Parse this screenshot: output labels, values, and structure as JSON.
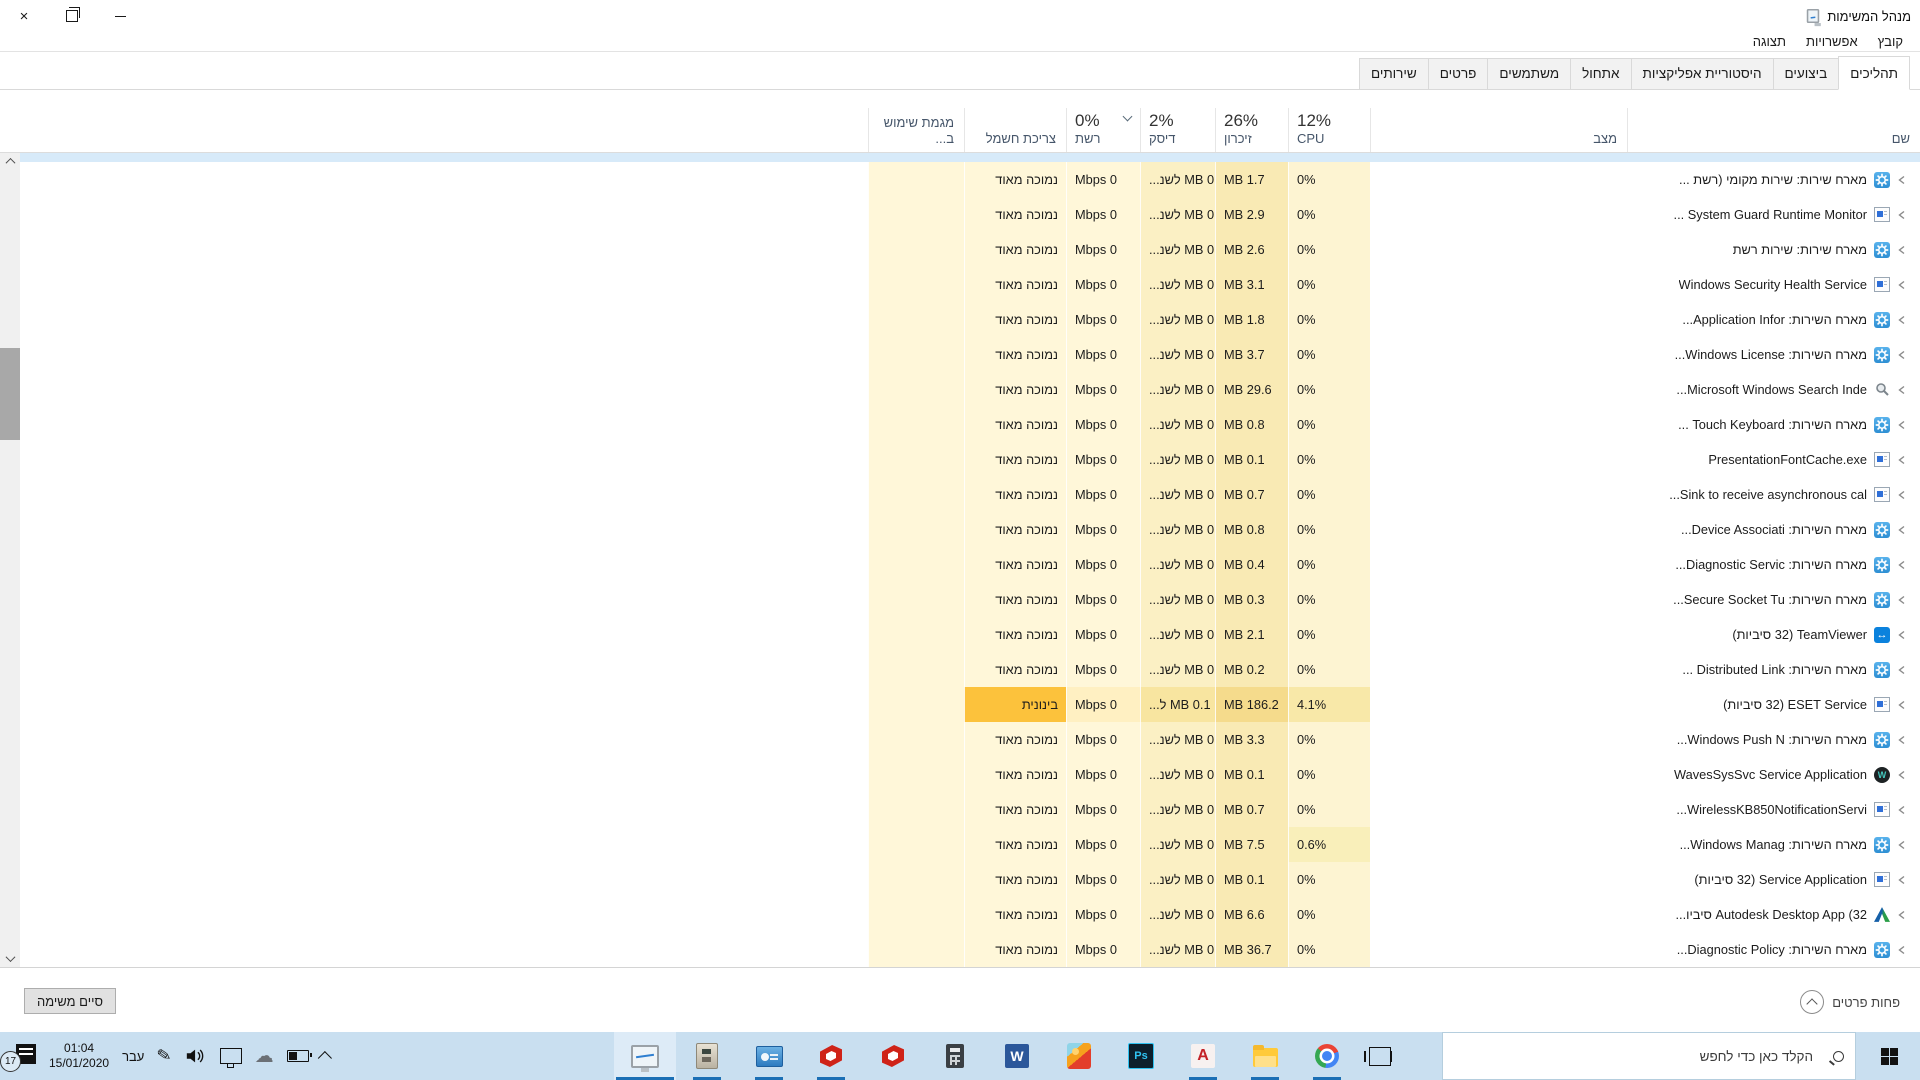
{
  "window": {
    "title": "מנהל המשימות",
    "controls": {
      "close": "×"
    }
  },
  "menu": {
    "items": [
      "קובץ",
      "אפשרויות",
      "תצוגה"
    ]
  },
  "tabs": {
    "active_index": 0,
    "items": [
      "תהליכים",
      "ביצועים",
      "היסטוריית אפליקציות",
      "אתחול",
      "משתמשים",
      "פרטים",
      "שירותים"
    ]
  },
  "columns": {
    "name": "שם",
    "status": "מצב",
    "cpu": {
      "value": "12%",
      "label": "CPU"
    },
    "memory": {
      "value": "26%",
      "label": "זיכרון"
    },
    "disk": {
      "value": "2%",
      "label": "דיסק"
    },
    "network": {
      "value": "0%",
      "label": "רשת",
      "sorted": true
    },
    "power": {
      "label": "צריכת חשמל"
    },
    "trend": {
      "label": "מגמת שימוש ב..."
    }
  },
  "table": {
    "rows": [
      {
        "icon": "gear",
        "name": "מארח שירות: שירות מקומי (רשת ...",
        "status": "",
        "cpu": "0%",
        "mem": "1.7 MB",
        "disk": "0 MB לשנ...",
        "net": "0 Mbps",
        "power": "נמוכה מאוד"
      },
      {
        "icon": "app",
        "name": "System Guard Runtime Monitor ...",
        "status": "",
        "cpu": "0%",
        "mem": "2.9 MB",
        "disk": "0 MB לשנ...",
        "net": "0 Mbps",
        "power": "נמוכה מאוד"
      },
      {
        "icon": "gear",
        "name": "מארח שירות: שירות רשת",
        "status": "",
        "cpu": "0%",
        "mem": "2.6 MB",
        "disk": "0 MB לשנ...",
        "net": "0 Mbps",
        "power": "נמוכה מאוד"
      },
      {
        "icon": "app",
        "name": "Windows Security Health Service",
        "status": "",
        "cpu": "0%",
        "mem": "3.1 MB",
        "disk": "0 MB לשנ...",
        "net": "0 Mbps",
        "power": "נמוכה מאוד"
      },
      {
        "icon": "gear",
        "name": "מארח השירות: Application Infor...",
        "status": "",
        "cpu": "0%",
        "mem": "1.8 MB",
        "disk": "0 MB לשנ...",
        "net": "0 Mbps",
        "power": "נמוכה מאוד"
      },
      {
        "icon": "gear",
        "name": "מארח השירות: Windows License...",
        "status": "",
        "cpu": "0%",
        "mem": "3.7 MB",
        "disk": "0 MB לשנ...",
        "net": "0 Mbps",
        "power": "נמוכה מאוד"
      },
      {
        "icon": "searchidx",
        "name": "Microsoft Windows Search Inde...",
        "status": "",
        "cpu": "0%",
        "mem": "29.6 MB",
        "disk": "0 MB לשנ...",
        "net": "0 Mbps",
        "power": "נמוכה מאוד"
      },
      {
        "icon": "gear",
        "name": "מארח השירות: Touch Keyboard ...",
        "status": "",
        "cpu": "0%",
        "mem": "0.8 MB",
        "disk": "0 MB לשנ...",
        "net": "0 Mbps",
        "power": "נמוכה מאוד"
      },
      {
        "icon": "app",
        "name": "PresentationFontCache.exe",
        "status": "",
        "cpu": "0%",
        "mem": "0.1 MB",
        "disk": "0 MB לשנ...",
        "net": "0 Mbps",
        "power": "נמוכה מאוד"
      },
      {
        "icon": "app",
        "name": "Sink to receive asynchronous cal...",
        "status": "",
        "cpu": "0%",
        "mem": "0.7 MB",
        "disk": "0 MB לשנ...",
        "net": "0 Mbps",
        "power": "נמוכה מאוד"
      },
      {
        "icon": "gear",
        "name": "מארח השירות: Device Associati...",
        "status": "",
        "cpu": "0%",
        "mem": "0.8 MB",
        "disk": "0 MB לשנ...",
        "net": "0 Mbps",
        "power": "נמוכה מאוד"
      },
      {
        "icon": "gear",
        "name": "מארח השירות: Diagnostic Servic...",
        "status": "",
        "cpu": "0%",
        "mem": "0.4 MB",
        "disk": "0 MB לשנ...",
        "net": "0 Mbps",
        "power": "נמוכה מאוד"
      },
      {
        "icon": "gear",
        "name": "מארח השירות: Secure Socket Tu...",
        "status": "",
        "cpu": "0%",
        "mem": "0.3 MB",
        "disk": "0 MB לשנ...",
        "net": "0 Mbps",
        "power": "נמוכה מאוד"
      },
      {
        "icon": "teamviewer",
        "name": "TeamViewer (32 סיביות)",
        "status": "",
        "cpu": "0%",
        "mem": "2.1 MB",
        "disk": "0 MB לשנ...",
        "net": "0 Mbps",
        "power": "נמוכה מאוד"
      },
      {
        "icon": "gear",
        "name": "מארח השירות: Distributed Link ...",
        "status": "",
        "cpu": "0%",
        "mem": "0.2 MB",
        "disk": "0 MB לשנ...",
        "net": "0 Mbps",
        "power": "נמוכה מאוד"
      },
      {
        "icon": "app",
        "name": "ESET Service (32 סיביות)",
        "status": "",
        "cpu": "4.1%",
        "mem": "186.2 MB",
        "disk": "0.1 MB ל...",
        "net": "0 Mbps",
        "power": "בינונית",
        "emphasis": "hot"
      },
      {
        "icon": "gear",
        "name": "מארח השירות: Windows Push N...",
        "status": "",
        "cpu": "0%",
        "mem": "3.3 MB",
        "disk": "0 MB לשנ...",
        "net": "0 Mbps",
        "power": "נמוכה מאוד"
      },
      {
        "icon": "waves",
        "name": "WavesSysSvc Service Application",
        "status": "",
        "cpu": "0%",
        "mem": "0.1 MB",
        "disk": "0 MB לשנ...",
        "net": "0 Mbps",
        "power": "נמוכה מאוד"
      },
      {
        "icon": "app",
        "name": "WirelessKB850NotificationServi...",
        "status": "",
        "cpu": "0%",
        "mem": "0.7 MB",
        "disk": "0 MB לשנ...",
        "net": "0 Mbps",
        "power": "נמוכה מאוד"
      },
      {
        "icon": "gear",
        "name": "מארח השירות: Windows Manag...",
        "status": "",
        "cpu": "0.6%",
        "mem": "7.5 MB",
        "disk": "0 MB לשנ...",
        "net": "0 Mbps",
        "power": "נמוכה מאוד",
        "emphasis": "warm"
      },
      {
        "icon": "app",
        "name": "Service Application (32 סיביות)",
        "status": "",
        "cpu": "0%",
        "mem": "0.1 MB",
        "disk": "0 MB לשנ...",
        "net": "0 Mbps",
        "power": "נמוכה מאוד"
      },
      {
        "icon": "autodesk",
        "name": "Autodesk Desktop App (32 סיביו...",
        "status": "",
        "cpu": "0%",
        "mem": "6.6 MB",
        "disk": "0 MB לשנ...",
        "net": "0 Mbps",
        "power": "נמוכה מאוד"
      },
      {
        "icon": "gear",
        "name": "מארח השירות: Diagnostic Policy...",
        "status": "",
        "cpu": "0%",
        "mem": "36.7 MB",
        "disk": "0 MB לשנ...",
        "net": "0 Mbps",
        "power": "נמוכה מאוד"
      }
    ]
  },
  "footer": {
    "fewer_details": "פחות פרטים",
    "end_task": "סיים משימה"
  },
  "taskbar": {
    "search_placeholder": "הקלד כאן כדי לחפש",
    "apps": [
      {
        "id": "task-manager",
        "running": true,
        "active": true
      },
      {
        "id": "machine-app",
        "running": true
      },
      {
        "id": "display-app",
        "running": true
      },
      {
        "id": "sketchup",
        "running": true
      },
      {
        "id": "sketchup-2",
        "running": false
      },
      {
        "id": "calculator",
        "running": false
      },
      {
        "id": "word",
        "running": false
      },
      {
        "id": "candy-crush",
        "running": false
      },
      {
        "id": "photoshop",
        "running": false
      },
      {
        "id": "autocad",
        "running": true
      },
      {
        "id": "file-explorer",
        "running": true
      },
      {
        "id": "chrome",
        "running": true
      }
    ],
    "tray": {
      "notification_badge": "17",
      "time": "01:04",
      "date": "15/01/2020",
      "language": "עבר"
    }
  },
  "colors": {
    "heat_base": "#fff7d9",
    "heat_memory": "#f9eab4",
    "heat_hot_power": "#fcc23c",
    "selection_strip": "#d7eaf9",
    "taskbar": "#c9dff0",
    "running_indicator": "#1b6fb5"
  }
}
